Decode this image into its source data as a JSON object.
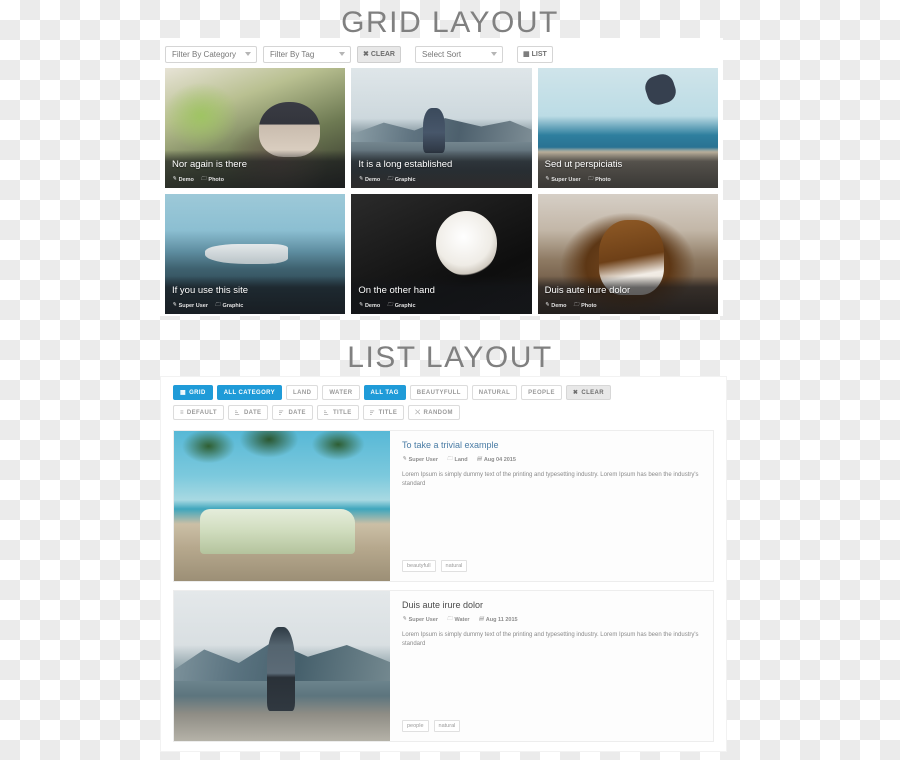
{
  "sections": {
    "grid_heading": "GRID LAYOUT",
    "list_heading": "LIST LAYOUT"
  },
  "colors": {
    "accent": "#1f9bd8",
    "heading": "#808080",
    "link": "#4a7ca5",
    "muted": "#8d8d8d"
  },
  "grid_toolbar": {
    "category_select": "Filter By Category",
    "tag_select": "Filter By Tag",
    "clear_label": "CLEAR",
    "sort_select": "Select Sort",
    "list_label": "LIST",
    "clear_icon": "times-icon",
    "list_icon": "list-icon"
  },
  "grid_cards": [
    {
      "title": "Nor again is there",
      "author": "Demo",
      "category": "Photo",
      "art": "p-stairs"
    },
    {
      "title": "It is a long established",
      "author": "Demo",
      "category": "Graphic",
      "art": "p-lake"
    },
    {
      "title": "Sed ut perspiciatis",
      "author": "Super User",
      "category": "Photo",
      "art": "p-beach"
    },
    {
      "title": "If you use this site",
      "author": "Super User",
      "category": "Graphic",
      "art": "p-wreck"
    },
    {
      "title": "On the other hand",
      "author": "Demo",
      "category": "Graphic",
      "art": "p-coffee"
    },
    {
      "title": "Duis aute irure dolor",
      "author": "Demo",
      "category": "Photo",
      "art": "p-dog"
    }
  ],
  "list_filters": [
    {
      "label": "GRID",
      "state": "active",
      "icon": "grid-icon"
    },
    {
      "label": "ALL CATEGORY",
      "state": "active",
      "icon": ""
    },
    {
      "label": "LAND",
      "state": "default",
      "icon": ""
    },
    {
      "label": "WATER",
      "state": "default",
      "icon": ""
    },
    {
      "label": "ALL TAG",
      "state": "active",
      "icon": ""
    },
    {
      "label": "BEAUTYFULL",
      "state": "default",
      "icon": ""
    },
    {
      "label": "NATURAL",
      "state": "default",
      "icon": ""
    },
    {
      "label": "PEOPLE",
      "state": "default",
      "icon": ""
    },
    {
      "label": "CLEAR",
      "state": "grey",
      "icon": "times-icon"
    }
  ],
  "list_sorts": [
    {
      "label": "DEFAULT",
      "icon": "bars-icon"
    },
    {
      "label": "DATE",
      "icon": "sort-amount-asc-icon"
    },
    {
      "label": "DATE",
      "icon": "sort-amount-desc-icon"
    },
    {
      "label": "TITLE",
      "icon": "sort-alpha-asc-icon"
    },
    {
      "label": "TITLE",
      "icon": "sort-alpha-desc-icon"
    },
    {
      "label": "RANDOM",
      "icon": "random-icon"
    }
  ],
  "list_items": [
    {
      "title": "To take a trivial example",
      "title_style": "link",
      "author": "Super User",
      "category": "Land",
      "date": "Aug 04 2015",
      "excerpt": "Lorem Ipsum is simply dummy text of the printing and typesetting industry. Lorem Ipsum has been the industry's standard",
      "tags": [
        "beautyfull",
        "natural"
      ],
      "art": "p-van"
    },
    {
      "title": "Duis aute irure dolor",
      "title_style": "dark",
      "author": "Super User",
      "category": "Water",
      "date": "Aug 11 2015",
      "excerpt": "Lorem Ipsum is simply dummy text of the printing and typesetting industry. Lorem Ipsum has been the industry's standard",
      "tags": [
        "people",
        "natural"
      ],
      "art": "p-pier"
    }
  ],
  "icons": {
    "pencil": "✎",
    "folder": "🗀",
    "calendar": "▤",
    "times": "✖",
    "bars": "≡",
    "random": "⤬",
    "grid": "▦"
  }
}
